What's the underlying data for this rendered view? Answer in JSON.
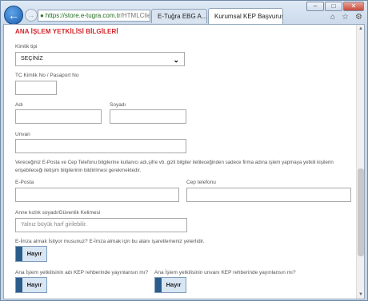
{
  "browser": {
    "address": {
      "url_host": "https://store.e-tugra.com.tr",
      "url_rest": "/HTMLClier",
      "tools": "▾ C"
    },
    "tabs": [
      {
        "label": "E-Tuğra EBG A...",
        "active": false
      },
      {
        "label": "Kurumsal KEP Başvurusu",
        "active": true
      }
    ],
    "window_controls": {
      "minimize": "–",
      "maximize": "□",
      "close": "✕"
    }
  },
  "form": {
    "section_title": "ANA İŞLEM YETKİLİSİ BİLGİLERİ",
    "id_type": {
      "label": "Kimlik tipi",
      "value": "SEÇİNİZ"
    },
    "tc_no": {
      "label": "TC Kimlik No / Pasaport No",
      "value": ""
    },
    "first_name": {
      "label": "Adı",
      "value": ""
    },
    "last_name": {
      "label": "Soyadı",
      "value": ""
    },
    "title": {
      "label": "Unvan",
      "value": ""
    },
    "info_text": "Vereceğiniz E-Posta ve Cep Telefonu bilgilerine kullanıcı adı,şifre vb. gizli bilgiler iletileceğinden sadece firma adına işlem yapmaya yetkili kişilerin erişebileceği iletişim bilgilerinin bildirilmesi gerekmektedir.",
    "email": {
      "label": "E-Posta",
      "value": ""
    },
    "mobile": {
      "label": "Cep telefonu",
      "value": ""
    },
    "security_word": {
      "label": "Anne kızlık soyadı/Güvenlik Kelimesi",
      "placeholder": "Yalnız büyük harf girilebilir."
    },
    "esign": {
      "label": "E-İmza almak İstiyor musunuz? E-İmza almak için bu alanı işaretlemeniz yeterlidir.",
      "toggle": "Hayır"
    },
    "publish_name": {
      "label": "Ana İşlem yetkilisinin adı KEP rehberinde yayınlansın mı?",
      "toggle": "Hayır"
    },
    "publish_title": {
      "label": "Ana İşlem yetkilisinin unvanı KEP rehberinde yayınlansın mı?",
      "toggle": "Hayır"
    }
  },
  "colors": {
    "section_title": "#d2232a",
    "toggle_knob": "#2b5d8c"
  }
}
